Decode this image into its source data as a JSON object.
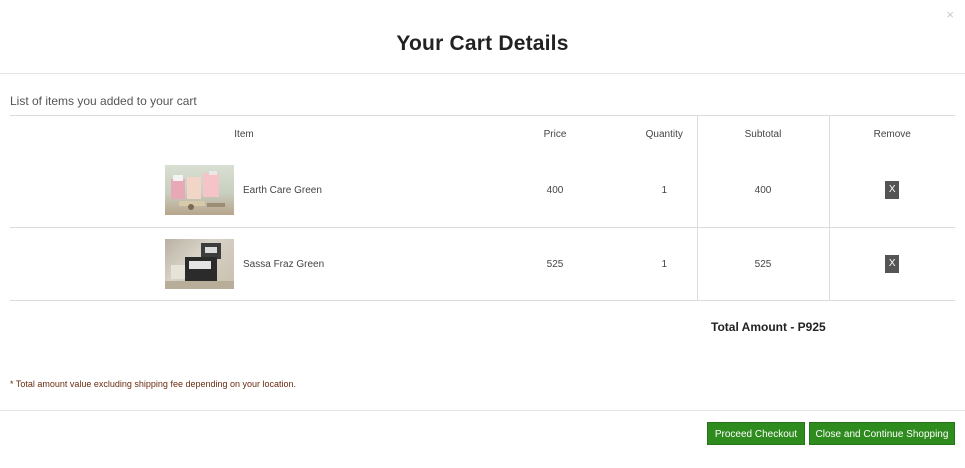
{
  "modal": {
    "close_glyph": "×",
    "title": "Your Cart Details",
    "list_caption": "List of items you added to your cart"
  },
  "table": {
    "headers": {
      "item": "Item",
      "price": "Price",
      "quantity": "Quantity",
      "subtotal": "Subtotal",
      "remove": "Remove"
    },
    "rows": [
      {
        "name": "Earth Care Green",
        "price": "400",
        "quantity": "1",
        "subtotal": "400",
        "remove": "X"
      },
      {
        "name": "Sassa Fraz Green",
        "price": "525",
        "quantity": "1",
        "subtotal": "525",
        "remove": "X"
      }
    ]
  },
  "total": "Total Amount - P925",
  "note": "* Total amount value excluding shipping fee depending on your location.",
  "buttons": {
    "checkout": "Proceed Checkout",
    "continue": "Close and Continue Shopping"
  },
  "colors": {
    "button_green": "#2e8b1e",
    "remove_button": "#555555",
    "note_text": "#6b2b10"
  }
}
